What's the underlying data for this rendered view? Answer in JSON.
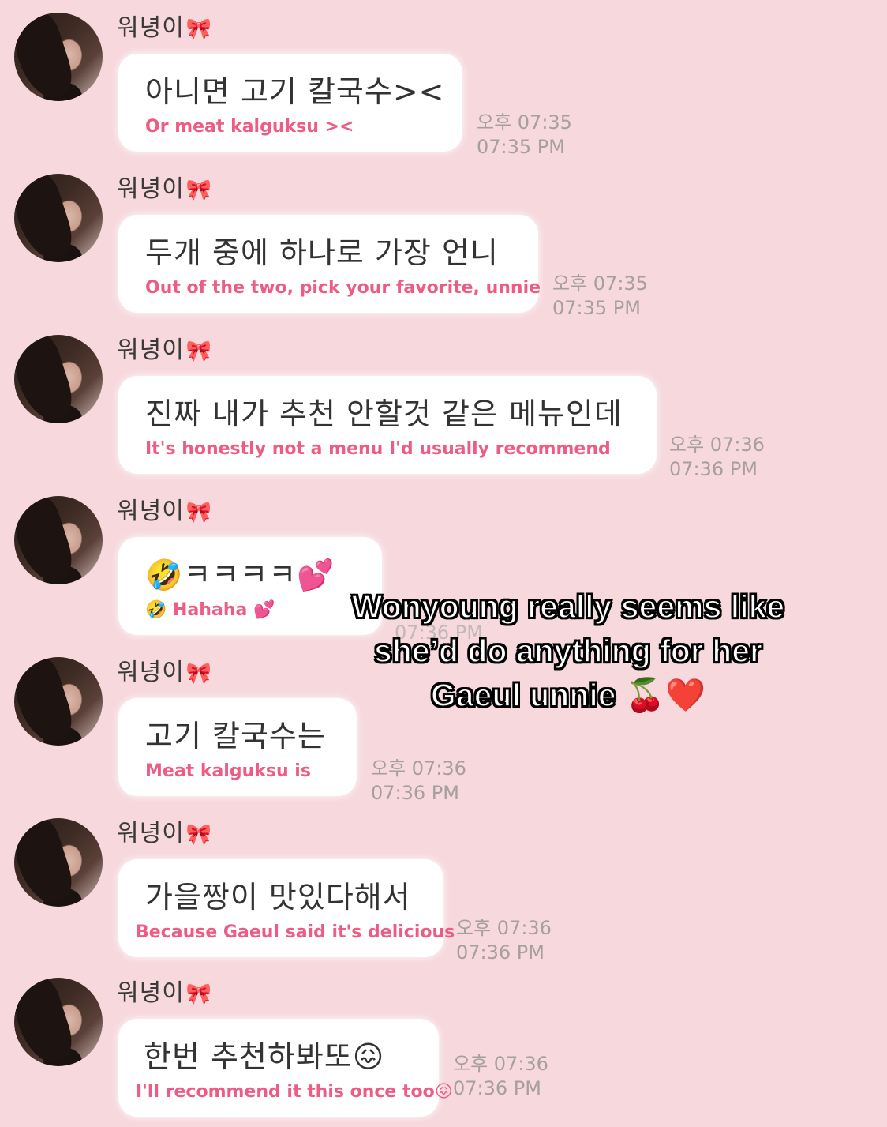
{
  "messages": [
    {
      "sender": "워녕이",
      "bow": "🎀",
      "korean": "아니면 고기 칼국수><",
      "english": "Or meat kalguksu ><",
      "time_ko": "오후 07:35",
      "time_en": "07:35 PM"
    },
    {
      "sender": "워녕이",
      "bow": "🎀",
      "korean": "두개 중에 하나로 가장 언니",
      "english": "Out of the two, pick your favorite, unnie",
      "time_ko": "오후 07:35",
      "time_en": "07:35 PM"
    },
    {
      "sender": "워녕이",
      "bow": "🎀",
      "korean": "진짜 내가 추천 안할것 같은 메뉴인데",
      "english": "It's honestly not a menu I'd usually recommend",
      "time_ko": "오후 07:36",
      "time_en": "07:36 PM"
    },
    {
      "sender": "워녕이",
      "bow": "🎀",
      "korean": "🤣ㅋㅋㅋㅋ💕",
      "english": "🤣 Hahaha 💕",
      "time_ko": "",
      "time_en": "07:36 PM"
    },
    {
      "sender": "워녕이",
      "bow": "🎀",
      "korean": "고기 칼국수는",
      "english": "Meat kalguksu is",
      "time_ko": "오후 07:36",
      "time_en": "07:36 PM"
    },
    {
      "sender": "워녕이",
      "bow": "🎀",
      "korean": "가을짱이 맛있다해서",
      "english": "Because Gaeul said it's delicious",
      "time_ko": "오후 07:36",
      "time_en": "07:36 PM"
    },
    {
      "sender": "워녕이",
      "bow": "🎀",
      "korean": "한번 추천하봐또😖",
      "english": "I'll recommend it this once too😖",
      "time_ko": "오후 07:36",
      "time_en": "07:36 PM"
    }
  ],
  "overlay": {
    "line1": "Wonyoung really seems like",
    "line2": "she’d do anything for her",
    "line3": "Gaeul unnie",
    "emoji": "🍒❤️"
  }
}
